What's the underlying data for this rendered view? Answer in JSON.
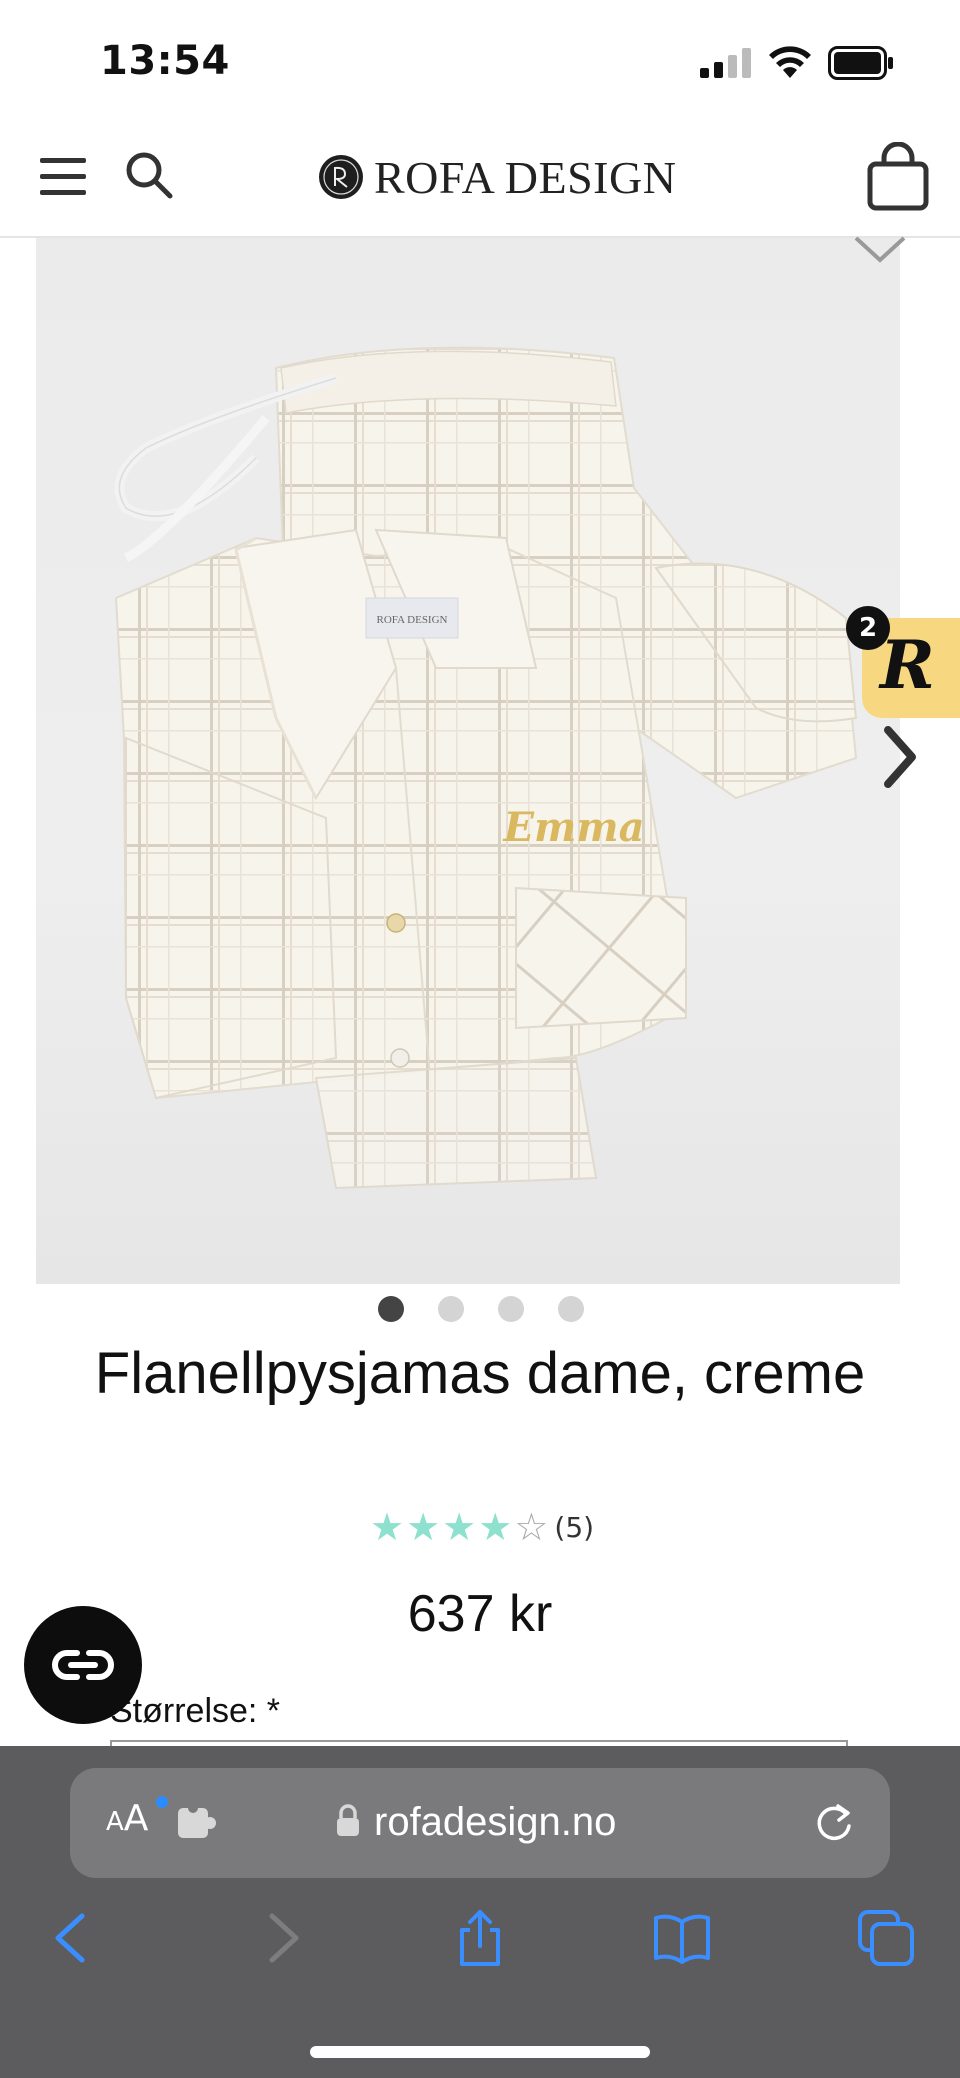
{
  "status_bar": {
    "time": "13:54"
  },
  "header": {
    "logo_text": "ROFA DESIGN",
    "icons": [
      "menu-icon",
      "search-icon",
      "shopping-bag-icon"
    ]
  },
  "product": {
    "image_alt": "Flanellpysjamas dame, creme",
    "label_on_garment": "ROFA DESIGN",
    "embroidery": "Emma",
    "title": "Flanellpysjamas dame, creme",
    "rating": 4,
    "rating_max": 5,
    "review_count": "(5)",
    "price": "637 kr",
    "size_label": "Størrelse: *",
    "image_count": 4,
    "active_image": 1
  },
  "reviews_widget": {
    "letter": "R",
    "count": "2",
    "accent": "#f7d780"
  },
  "browser": {
    "text_size_button": "AA",
    "url": "rofadesign.no",
    "bar_color": "#5c5c5e",
    "nav_icons": [
      "back-icon",
      "forward-icon",
      "share-icon",
      "bookmarks-icon",
      "tabs-icon"
    ]
  },
  "colors": {
    "star": "#8ee0cf",
    "link_blue": "#2b8cff"
  }
}
